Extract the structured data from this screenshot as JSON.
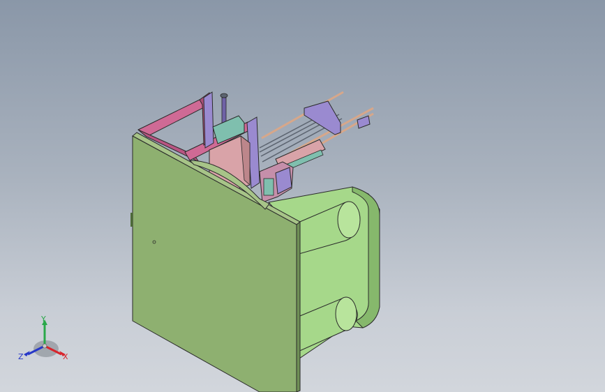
{
  "viewport": {
    "background_top": "#8a97a8",
    "background_bottom": "#d2d6dc"
  },
  "model": {
    "colors": {
      "base_plate": "#8eb070",
      "base_plate_dark": "#6f8f55",
      "base_plate_edge": "#a7c488",
      "frame_pink": "#cf6a95",
      "frame_pink_dark": "#a84f76",
      "bracket_purple": "#9a8ad0",
      "bracket_purple_dark": "#6f62a6",
      "rod_copper": "#d7a78a",
      "rod_steel": "#5c6470",
      "block_teal": "#7fbfae",
      "block_rose": "#d9a3a8",
      "arm_green": "#a6d88a",
      "arm_green_dark": "#86b86c",
      "outline": "#2a2a2a"
    }
  },
  "triad": {
    "x_label": "X",
    "y_label": "Y",
    "z_label": "Z",
    "x_color": "#d8242c",
    "y_color": "#2aa84a",
    "z_color": "#2637c8"
  }
}
